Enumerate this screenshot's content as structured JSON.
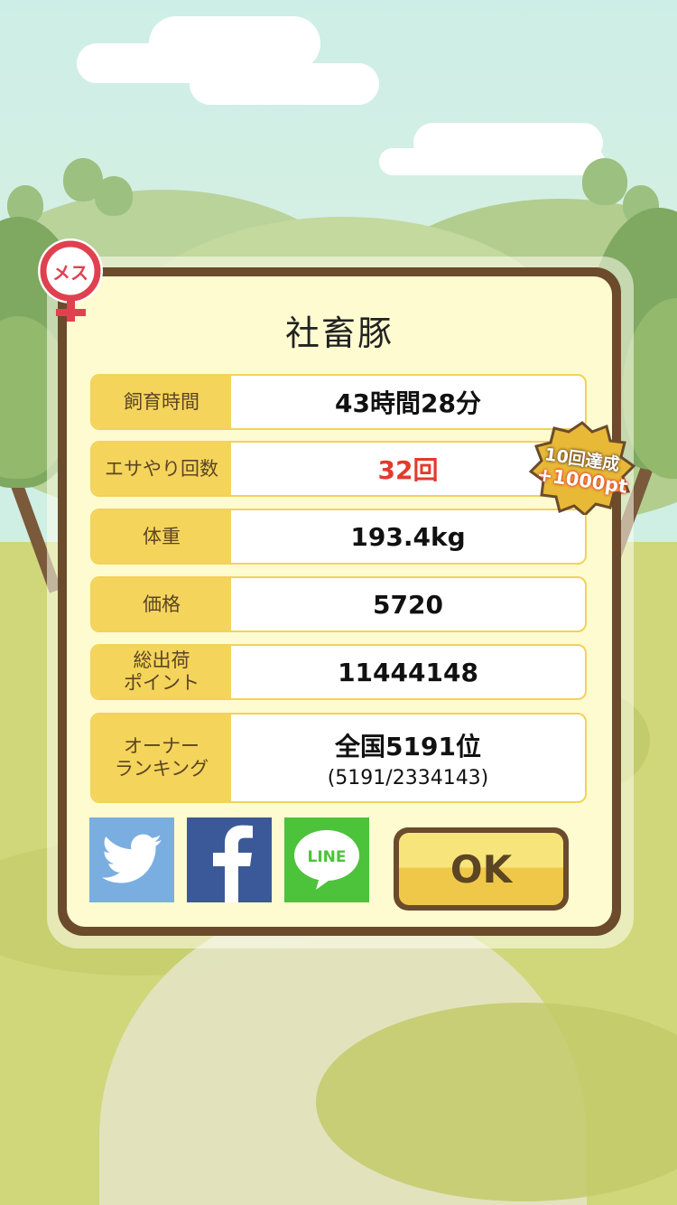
{
  "dialog": {
    "title": "社畜豚",
    "female_mark": "メス",
    "rows": [
      {
        "label": "飼育時間",
        "value": "43時間28分"
      },
      {
        "label": "エサやり回数",
        "value": "32回"
      },
      {
        "label": "体重",
        "value": "193.4kg"
      },
      {
        "label": "価格",
        "value": "5720"
      },
      {
        "label_line1": "総出荷",
        "label_line2": "ポイント",
        "value": "11444148"
      },
      {
        "label_line1": "オーナー",
        "label_line2": "ランキング",
        "value": "全国5191位",
        "sub": "(5191/2334143)"
      }
    ],
    "badge": {
      "line1": "10回達成",
      "line2": "+1000pt"
    },
    "ok_label": "OK",
    "line_label": "LINE"
  },
  "colors": {
    "frame_brown": "#6b4b2c",
    "panel_cream": "#fffbd0",
    "label_yellow": "#f5d45c",
    "highlight_red": "#e23b2c",
    "twitter_blue": "#7aaee0",
    "facebook_blue": "#3b5998",
    "line_green": "#4cc33a"
  }
}
